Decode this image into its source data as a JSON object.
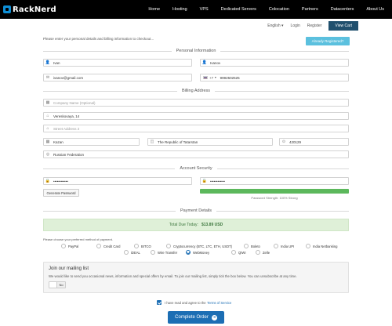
{
  "nav": {
    "logo": "RackNerd",
    "links": [
      "Home",
      "Hosting",
      "VPS",
      "Dedicated Servers",
      "Colocation",
      "Partners",
      "Datacenters",
      "About Us"
    ]
  },
  "subnav": {
    "language": "English",
    "login": "Login",
    "register": "Register",
    "view_cart": "View Cart"
  },
  "intro": "Please enter your personal details and billing information to checkout...",
  "already_registered": "Already Registered?",
  "sections": {
    "personal": "Personal Information",
    "billing": "Billing Address",
    "security": "Account Security",
    "payment": "Payment Details"
  },
  "personal": {
    "first_name": "Ivan",
    "last_name": "Ivanov",
    "email": "ivanov@gmail.com",
    "phone_code": "+7",
    "phone": "9992502525"
  },
  "billing": {
    "company_placeholder": "Company Name (Optional)",
    "street1": "Vereskovaya, 14",
    "street2_placeholder": "Street Address 2",
    "city": "Kazan",
    "state": "The Republic of Tatarstan",
    "postcode": "420129",
    "country": "Russian Federation"
  },
  "security": {
    "password": "••••••••••••",
    "confirm": "••••••••••••",
    "generate_label": "Generate Password",
    "strength_text": "Password Strength: 100% Strong",
    "strength_fraction": 1.0
  },
  "payment": {
    "total_label": "Total Due Today:",
    "total_value": "$13.89 USD",
    "choose_text": "Please choose your preferred method of payment.",
    "methods_row1": [
      "PayPal",
      "Credit Card",
      "BITCO",
      "Cryptocurrency (BTC, LTC, ETH, USDT)",
      "Boleto",
      "India UPI",
      "India Netbanking"
    ],
    "methods_row2": [
      "iDEAL",
      "Wire Transfer",
      "WebMoney",
      "QIWI",
      "Zelle"
    ],
    "selected": "WebMoney"
  },
  "mailing": {
    "title": "Join our mailing list",
    "text": "We would like to send you occasional news, information and special offers by email. To join our mailing list, simply tick the box below. You can unsubscribe at any time.",
    "toggle_label": "No"
  },
  "tos": {
    "prefix": "I have read and agree to the",
    "link": "Terms of Service"
  },
  "complete_order": "Complete Order"
}
